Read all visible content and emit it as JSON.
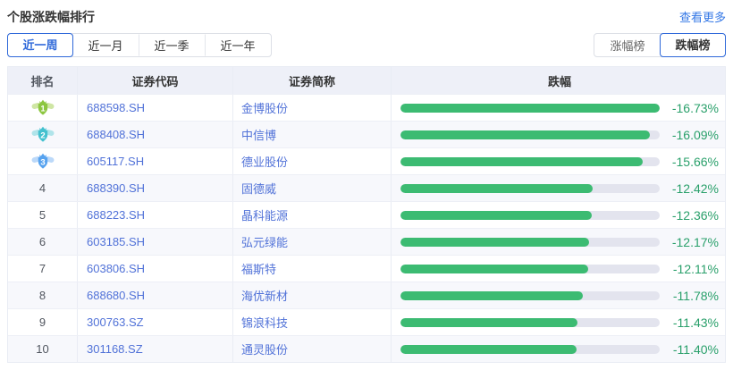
{
  "panel": {
    "title": "个股涨跌幅排行",
    "view_more": "查看更多"
  },
  "period_tabs": [
    {
      "label": "近一周",
      "active": true
    },
    {
      "label": "近一月",
      "active": false
    },
    {
      "label": "近一季",
      "active": false
    },
    {
      "label": "近一年",
      "active": false
    }
  ],
  "rank_toggle": [
    {
      "label": "涨幅榜",
      "active": false,
      "name": "gainers"
    },
    {
      "label": "跌幅榜",
      "active": true,
      "name": "losers"
    }
  ],
  "table": {
    "headers": [
      "排名",
      "证券代码",
      "证券简称",
      "跌幅"
    ],
    "max_decline_pct": 16.73,
    "rows": [
      {
        "rank": 1,
        "code": "688598.SH",
        "name": "金博股份",
        "pct_label": "-16.73%",
        "pct_value": 16.73
      },
      {
        "rank": 2,
        "code": "688408.SH",
        "name": "中信博",
        "pct_label": "-16.09%",
        "pct_value": 16.09
      },
      {
        "rank": 3,
        "code": "605117.SH",
        "name": "德业股份",
        "pct_label": "-15.66%",
        "pct_value": 15.66
      },
      {
        "rank": 4,
        "code": "688390.SH",
        "name": "固德威",
        "pct_label": "-12.42%",
        "pct_value": 12.42
      },
      {
        "rank": 5,
        "code": "688223.SH",
        "name": "晶科能源",
        "pct_label": "-12.36%",
        "pct_value": 12.36
      },
      {
        "rank": 6,
        "code": "603185.SH",
        "name": "弘元绿能",
        "pct_label": "-12.17%",
        "pct_value": 12.17
      },
      {
        "rank": 7,
        "code": "603806.SH",
        "name": "福斯特",
        "pct_label": "-12.11%",
        "pct_value": 12.11
      },
      {
        "rank": 8,
        "code": "688680.SH",
        "name": "海优新材",
        "pct_label": "-11.78%",
        "pct_value": 11.78
      },
      {
        "rank": 9,
        "code": "300763.SZ",
        "name": "锦浪科技",
        "pct_label": "-11.43%",
        "pct_value": 11.43
      },
      {
        "rank": 10,
        "code": "301168.SZ",
        "name": "通灵股份",
        "pct_label": "-11.40%",
        "pct_value": 11.4
      }
    ]
  },
  "medals": [
    {
      "rank": 1,
      "body": "#8cc63f",
      "wing": "#cfe6a4"
    },
    {
      "rank": 2,
      "body": "#44c1cf",
      "wing": "#b0e4ea"
    },
    {
      "rank": 3,
      "body": "#57a3ef",
      "wing": "#bcd9f9"
    }
  ],
  "colors": {
    "accent_blue": "#2e68d9",
    "link_blue": "#3377e6",
    "stock_link_blue": "#5172d8",
    "bar_green": "#3cbb72",
    "bar_track": "#e3e4ee",
    "pct_green": "#2aa06b",
    "header_bg": "#eef0f8",
    "row_alt_bg": "#f7f8fc"
  }
}
